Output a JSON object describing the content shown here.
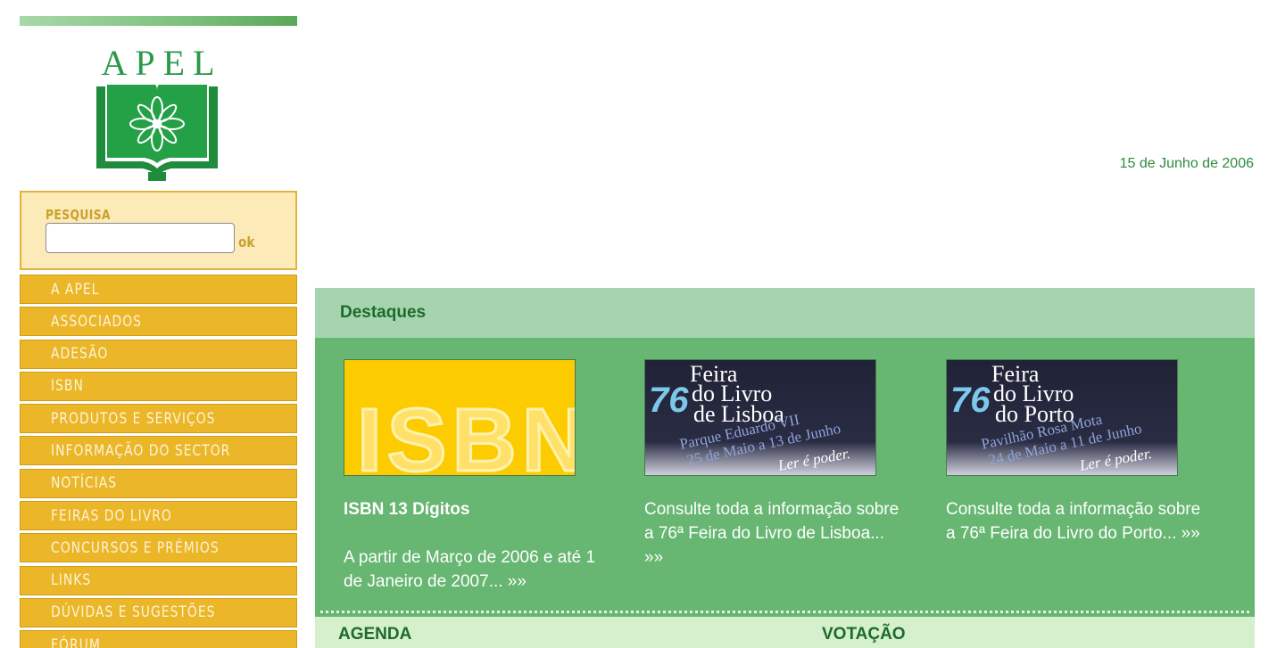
{
  "logo": {
    "text": "APEL"
  },
  "search": {
    "label": "PESQUISA",
    "value": "",
    "ok_label": "ok"
  },
  "nav": [
    {
      "label": "A APEL"
    },
    {
      "label": "ASSOCIADOS"
    },
    {
      "label": "ADESÃO"
    },
    {
      "label": "ISBN"
    },
    {
      "label": "PRODUTOS E SERVIÇOS"
    },
    {
      "label": "INFORMAÇÃO DO SECTOR"
    },
    {
      "label": "NOTÍCIAS"
    },
    {
      "label": "FEIRAS DO LIVRO"
    },
    {
      "label": "CONCURSOS E PRÉMIOS"
    },
    {
      "label": "LINKS"
    },
    {
      "label": "DÚVIDAS E SUGESTÕES"
    },
    {
      "label": "FÓRUM"
    }
  ],
  "date": "15 de Junho de 2006",
  "destaques": {
    "title": "Destaques",
    "cards": [
      {
        "image": {
          "text": "ISBN"
        },
        "title": "ISBN 13 Dígitos",
        "text_lines": [
          "A partir de Março de 2006 e até 1",
          "de Janeiro de 2007... »»"
        ]
      },
      {
        "image": {
          "number": "76",
          "line1": "Feira",
          "line2": "do Livro",
          "line3": "de Lisboa",
          "line4": "Parque Eduardo VII",
          "line5": "25 de Maio a 13 de Junho",
          "slogan": "Ler é poder."
        },
        "text_lines": [
          "Consulte toda a informação sobre",
          "a 76ª Feira do Livro de Lisboa...",
          "»»"
        ]
      },
      {
        "image": {
          "number": "76",
          "line1": "Feira",
          "line2": "do Livro",
          "line3": "do Porto",
          "line4": "Pavilhão Rosa Mota",
          "line5": "24 de Maio a 11 de Junho",
          "slogan": "Ler é poder."
        },
        "text_lines": [
          "Consulte toda a informação sobre",
          "a 76ª Feira do Livro do Porto... »»"
        ]
      }
    ]
  },
  "agenda": {
    "title": "AGENDA"
  },
  "votacao": {
    "title": "VOTAÇÃO"
  },
  "colors": {
    "nav": "#ebb628",
    "dest_body": "#67b672",
    "dest_header": "#a5d4ae",
    "bottom_bar": "#d4f0cc",
    "brand_green": "#2a9a4a"
  }
}
